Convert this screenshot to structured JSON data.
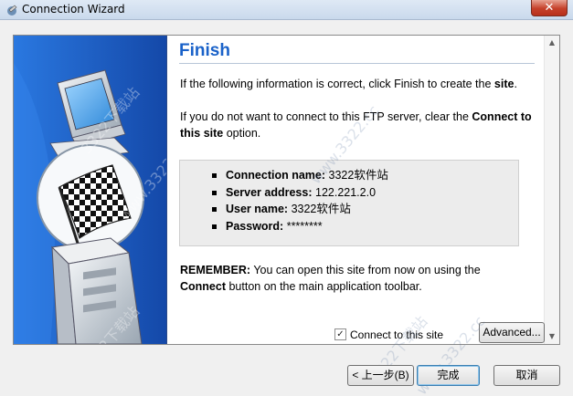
{
  "window": {
    "title": "Connection Wizard",
    "close_glyph": "✕"
  },
  "page": {
    "heading": "Finish",
    "para1_prefix": "If the following information is correct, click Finish to create the ",
    "para1_bold": "site",
    "para1_suffix": ".",
    "para2_prefix": "If you do not want to connect to this FTP server, clear the ",
    "para2_bold": "Connect to this site",
    "para2_suffix": " option.",
    "info": [
      {
        "label": "Connection name:",
        "value": "3322软件站"
      },
      {
        "label": "Server address:",
        "value": "122.221.2.0"
      },
      {
        "label": "User name:",
        "value": "3322软件站"
      },
      {
        "label": "Password:",
        "value": "********"
      }
    ],
    "remember_label": "REMEMBER:",
    "remember_text1": " You can open this site from now on using the",
    "remember_bold": "Connect",
    "remember_text2": " button on the main application toolbar."
  },
  "options": {
    "connect_label": "Connect to this site",
    "connect_checked": true,
    "advanced_label": "Advanced..."
  },
  "footer": {
    "back_label": "< 上一步(B)",
    "finish_label": "完成",
    "cancel_label": "取消"
  },
  "watermarks": [
    "3322下载站",
    "www.3322.cc"
  ],
  "icons": {
    "app": "ftp-app-icon",
    "side": "wizard-finish-flag-illustration"
  },
  "colors": {
    "heading": "#1a62c9",
    "side_panel": "#1a5fc8",
    "info_box": "#ececec"
  }
}
